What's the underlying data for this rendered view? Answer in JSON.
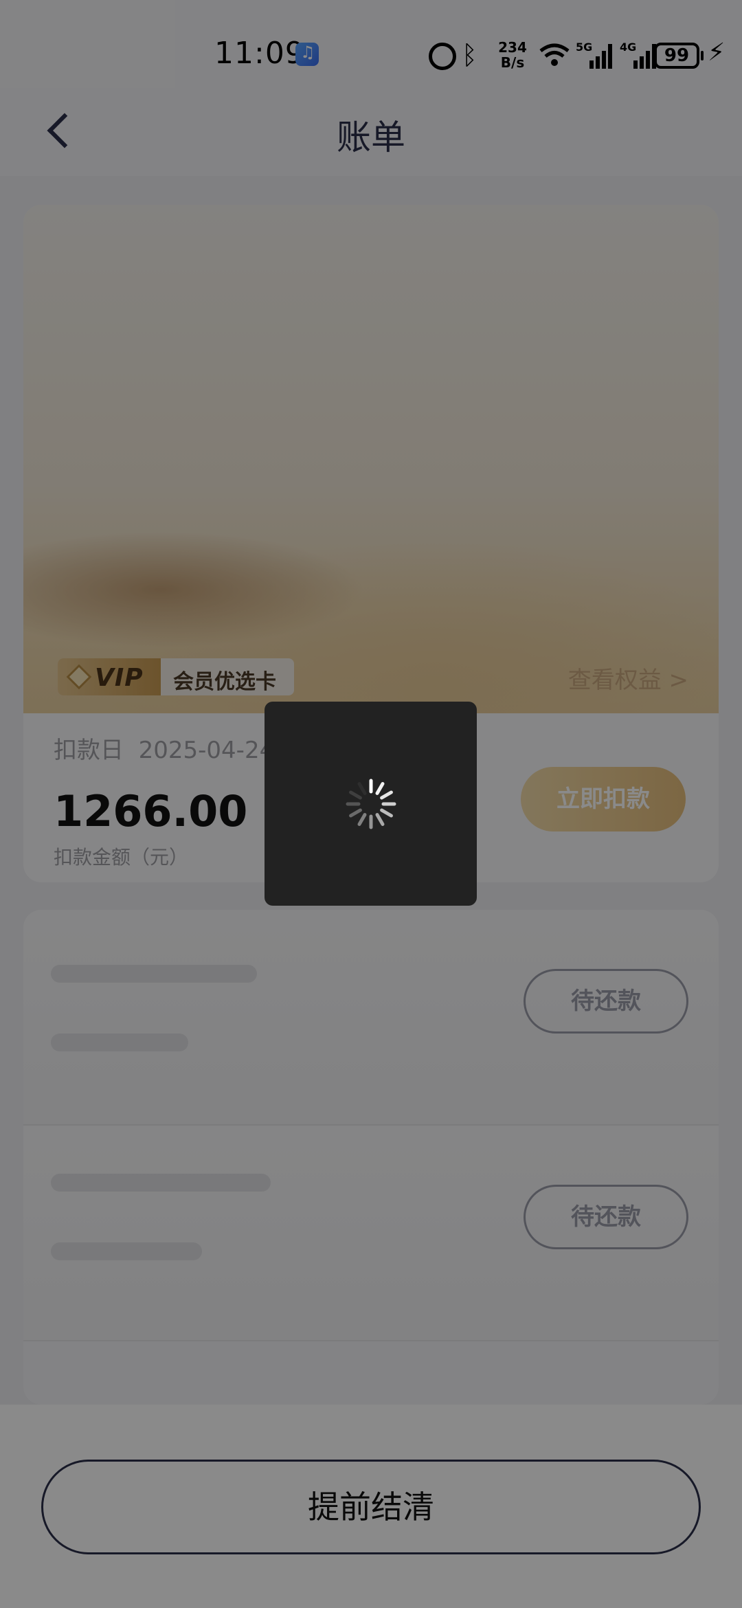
{
  "status_bar": {
    "time": "11:09",
    "net_speed_value": "234",
    "net_speed_unit": "B/s",
    "battery": "99",
    "icons": [
      "music-app-icon",
      "alarm-icon",
      "bluetooth-icon",
      "wifi-icon",
      "signal-5g-icon",
      "signal-4g-icon",
      "battery-icon",
      "charging-icon"
    ]
  },
  "header": {
    "title": "账单",
    "back_icon": "chevron-left-icon"
  },
  "vip_card": {
    "badge_text": "VIP",
    "badge_label": "会员优选卡",
    "benefit_link": "查看权益 >",
    "debit_date_label": "扣款日",
    "debit_date": "2025-04-24",
    "amount": "1266.00",
    "amount_label": "扣款金额（元）",
    "pay_now_label": "立即扣款",
    "accent_color": "#e6be7c"
  },
  "repayment_list": {
    "rows": [
      {
        "status": "待还款"
      },
      {
        "status": "待还款"
      }
    ]
  },
  "footer": {
    "settle_label": "提前结清"
  },
  "loading": {
    "visible": true,
    "icon": "spinner-icon"
  }
}
